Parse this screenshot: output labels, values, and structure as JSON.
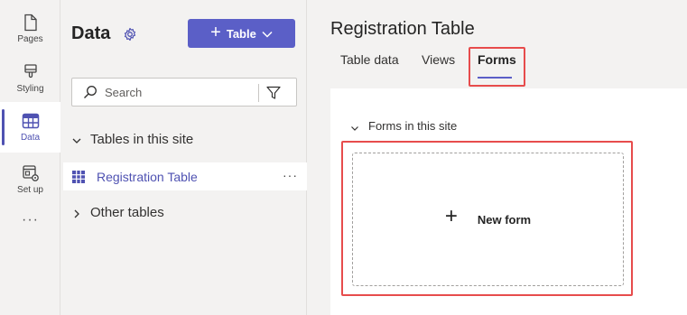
{
  "rail": {
    "items": [
      {
        "label": "Pages",
        "icon": "page-icon"
      },
      {
        "label": "Styling",
        "icon": "paintbrush-icon"
      },
      {
        "label": "Data",
        "icon": "table-icon",
        "active": true
      },
      {
        "label": "Set up",
        "icon": "settings-window-icon"
      }
    ],
    "more": "···"
  },
  "data_pane": {
    "title": "Data",
    "settings_icon": "gear-icon",
    "table_button_label": "Table",
    "search_placeholder": "Search",
    "sections": {
      "site_tables": "Tables in this site",
      "other_tables": "Other tables"
    },
    "selected_table": "Registration Table",
    "more": "···"
  },
  "main": {
    "title": "Registration Table",
    "tabs": [
      "Table data",
      "Views",
      "Forms"
    ],
    "active_tab": "Forms",
    "forms_section_label": "Forms in this site",
    "new_form_label": "New form"
  },
  "colors": {
    "accent": "#5b5fc7",
    "highlight": "#e74c4c"
  }
}
